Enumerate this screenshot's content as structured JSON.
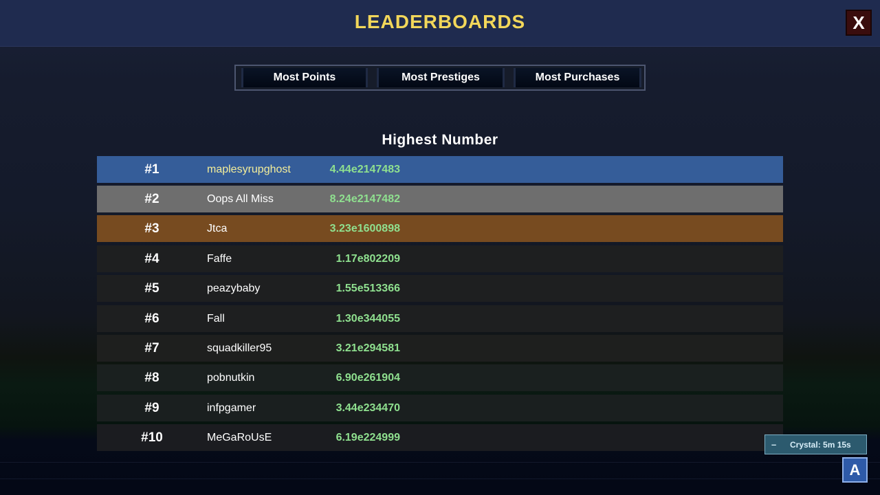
{
  "header": {
    "title": "LEADERBOARDS",
    "close_label": "X"
  },
  "tabs": [
    {
      "label": "Most Points"
    },
    {
      "label": "Most Prestiges"
    },
    {
      "label": "Most Purchases"
    }
  ],
  "section_title": "Highest Number",
  "leaderboard": [
    {
      "rank": "#1",
      "name": "maplesyrupghost",
      "score": "4.44e2147483",
      "row_color": "#355d99",
      "name_color": "#f4ee9a"
    },
    {
      "rank": "#2",
      "name": "Oops All Miss",
      "score": "8.24e2147482",
      "row_color": "#6e6e6e",
      "name_color": "#ffffff"
    },
    {
      "rank": "#3",
      "name": "Jtca",
      "score": "3.23e1600898",
      "row_color": "#774b20",
      "name_color": "#ffffff"
    },
    {
      "rank": "#4",
      "name": "Faffe",
      "score": "1.17e802209",
      "row_color": "#1e1f20",
      "name_color": "#ffffff"
    },
    {
      "rank": "#5",
      "name": "peazybaby",
      "score": "1.55e513366",
      "row_color": "#1e1f20",
      "name_color": "#ffffff"
    },
    {
      "rank": "#6",
      "name": "Fall",
      "score": "1.30e344055",
      "row_color": "#1e1f20",
      "name_color": "#ffffff"
    },
    {
      "rank": "#7",
      "name": "squadkiller95",
      "score": "3.21e294581",
      "row_color": "#1e1f1e",
      "name_color": "#ffffff"
    },
    {
      "rank": "#8",
      "name": "pobnutkin",
      "score": "6.90e261904",
      "row_color": "#1a201f",
      "name_color": "#ffffff"
    },
    {
      "rank": "#9",
      "name": "infpgamer",
      "score": "3.44e234470",
      "row_color": "#1a1f1f",
      "name_color": "#ffffff"
    },
    {
      "rank": "#10",
      "name": "MeGaRoUsE",
      "score": "6.19e224999",
      "row_color": "#1b1c20",
      "name_color": "#ffffff"
    }
  ],
  "crystal": {
    "minus_label": "–",
    "text": "Crystal: 5m 15s"
  },
  "a_button": {
    "label": "A"
  },
  "colors": {
    "title": "#f2d75a",
    "score": "#8fe08f",
    "header_bg": "#1f2b4f"
  }
}
